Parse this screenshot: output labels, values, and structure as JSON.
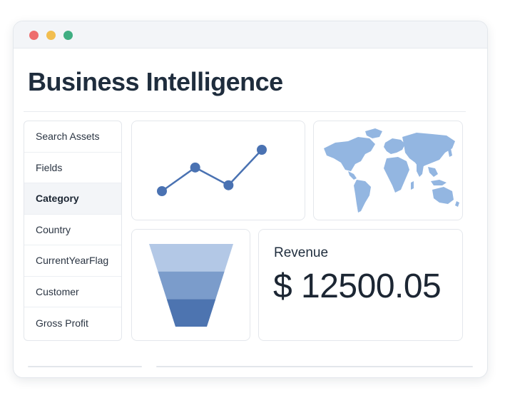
{
  "window": {
    "controls": [
      "close",
      "minimize",
      "maximize"
    ]
  },
  "header": {
    "title": "Business Intelligence"
  },
  "sidebar": {
    "items": [
      {
        "label": "Search Assets",
        "active": false
      },
      {
        "label": "Fields",
        "active": false
      },
      {
        "label": "Category",
        "active": true
      },
      {
        "label": "Country",
        "active": false
      },
      {
        "label": "CurrentYearFlag",
        "active": false
      },
      {
        "label": "Customer",
        "active": false
      },
      {
        "label": "Gross Profit",
        "active": false
      }
    ]
  },
  "widgets": {
    "line_chart": {
      "values": [
        1,
        3,
        1.5,
        4.5
      ],
      "color": "#4a72b2"
    },
    "world_map": {
      "color": "#93b6e1",
      "icon": "world-map-icon"
    },
    "funnel": {
      "stages": [
        3,
        2,
        1
      ],
      "colors": [
        "#b3c8e6",
        "#7b9ccb",
        "#4d74b0"
      ]
    },
    "revenue": {
      "label": "Revenue",
      "value": "$ 12500.05"
    }
  },
  "colors": {
    "accent": "#4a72b2",
    "text": "#1f2d3d",
    "close": "#ee6d6d",
    "minimize": "#f2be4f",
    "maximize": "#3fae82"
  }
}
